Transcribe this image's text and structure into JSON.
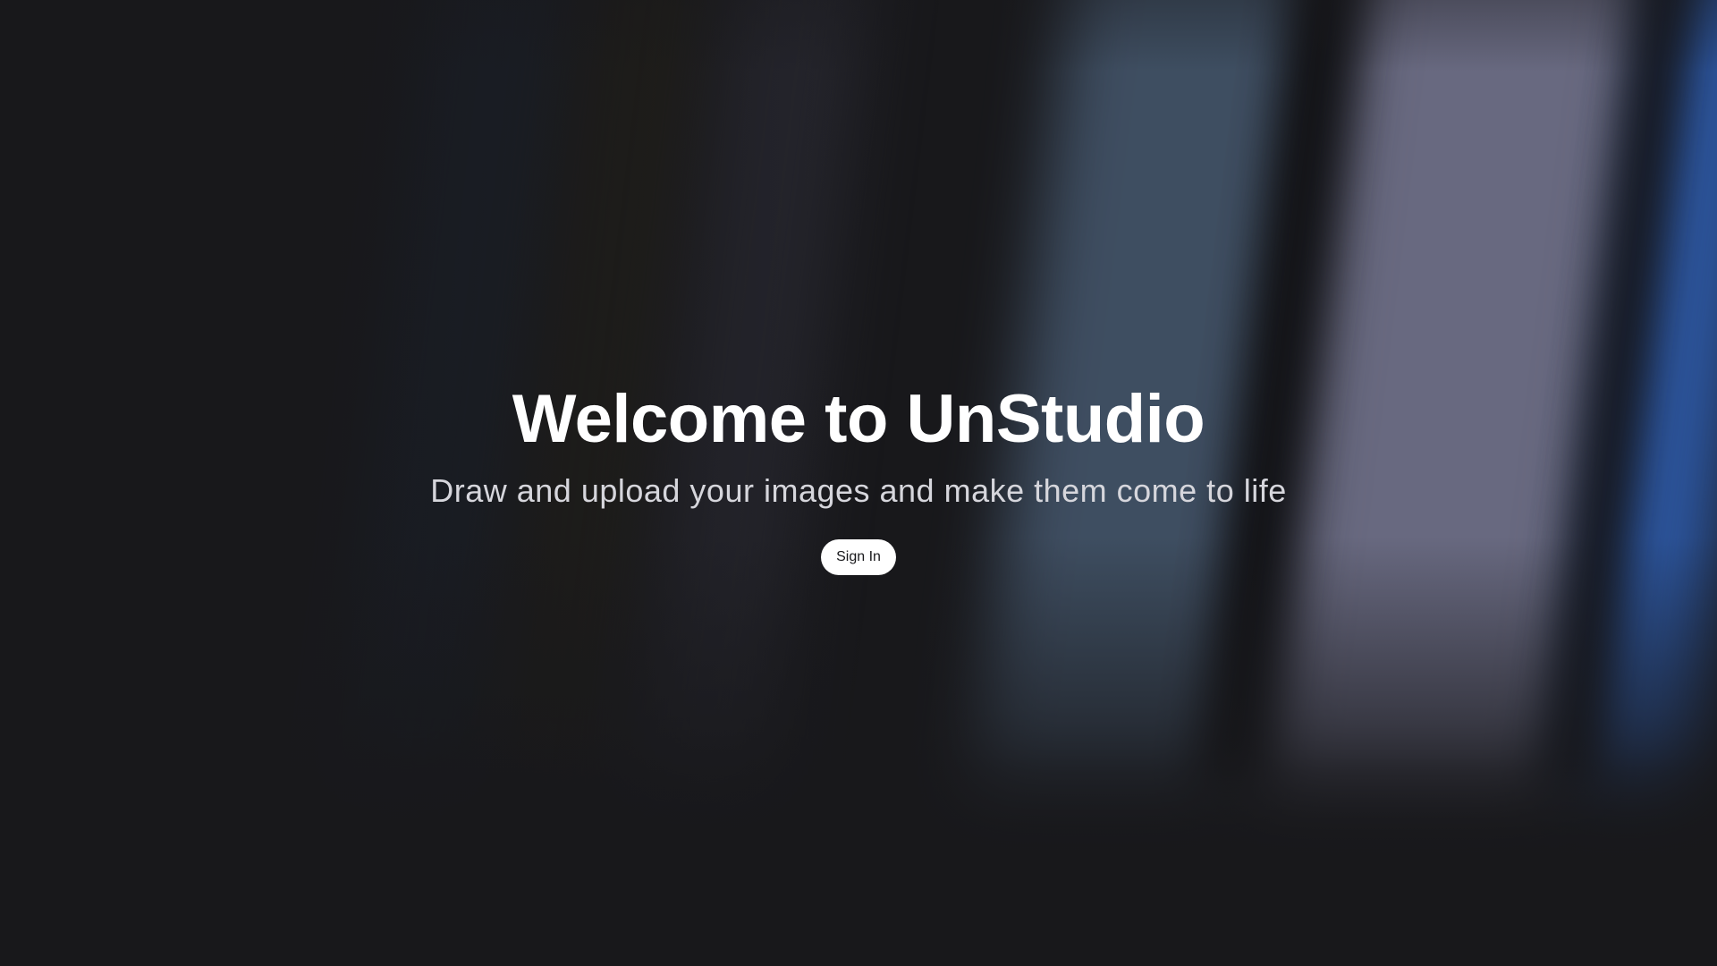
{
  "hero": {
    "title": "Welcome to UnStudio",
    "subtitle": "Draw and upload your images and make them come to life",
    "signin_label": "Sign In"
  },
  "colors": {
    "background": "#18181b",
    "title_text": "#ffffff",
    "subtitle_text": "#d6d6dc",
    "button_bg": "#ffffff",
    "button_text": "#18181b",
    "accent_blue": "#2c56a0",
    "accent_lavender": "#6d6e86"
  }
}
